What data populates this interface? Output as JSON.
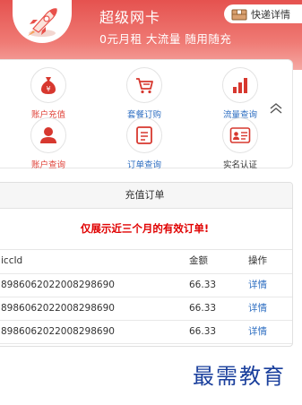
{
  "header": {
    "title": "超级网卡",
    "subtitle": "0元月租 大流量 随用随充",
    "delivery_label": "快递详情",
    "brand_color": "#e5524f"
  },
  "menu": {
    "items": [
      {
        "label": "账户充值",
        "icon": "money-bag-icon",
        "color": "#e0443b"
      },
      {
        "label": "套餐订购",
        "icon": "shopping-cart-icon",
        "color": "#2f6fc2"
      },
      {
        "label": "流量查询",
        "icon": "bar-chart-icon",
        "color": "#2f6fc2"
      },
      {
        "label": "账户查询",
        "icon": "user-icon",
        "color": "#e0443b"
      },
      {
        "label": "订单查询",
        "icon": "order-list-icon",
        "color": "#2f6fc2"
      },
      {
        "label": "实名认证",
        "icon": "id-card-icon",
        "color": "#333333"
      }
    ],
    "collapse_icon": "chevron-up-double-icon"
  },
  "orders": {
    "title": "充值订单",
    "notice": "仅展示近三个月的有效订单!",
    "columns": [
      "iccId",
      "金额",
      "操作"
    ],
    "rows": [
      {
        "iccid": "8986062022008298690",
        "amount": "66.33",
        "action": "详情"
      },
      {
        "iccid": "8986062022008298690",
        "amount": "66.33",
        "action": "详情"
      },
      {
        "iccid": "8986062022008298690",
        "amount": "66.33",
        "action": "详情"
      }
    ]
  },
  "watermark": "最需教育"
}
